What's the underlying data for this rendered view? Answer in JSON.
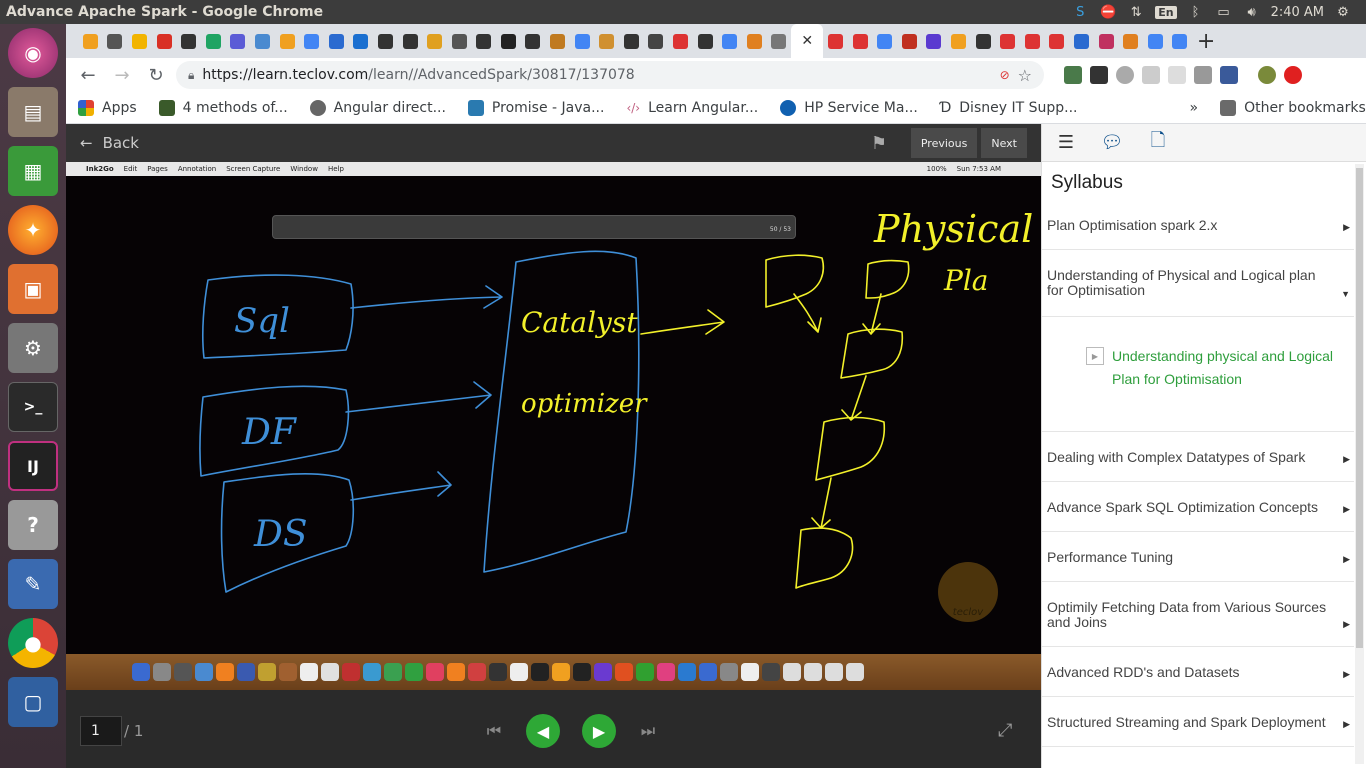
{
  "window_title": "Advance Apache Spark - Google Chrome",
  "panel": {
    "keyboard": "En",
    "time": "2:40 AM"
  },
  "browser": {
    "url_host": "https://learn.teclov.com",
    "url_path": "/learn//AdvancedSpark/30817/137078",
    "bookmarks": [
      "Apps",
      "4 methods of...",
      "Angular direct...",
      "Promise - Java...",
      "Learn Angular...",
      "HP Service Ma...",
      "Disney IT Supp...",
      "Other bookmarks"
    ],
    "bookmarks_overflow": "»"
  },
  "player": {
    "back_label": "Back",
    "previous_label": "Previous",
    "next_label": "Next",
    "page_current": "1",
    "page_total": "/ 1",
    "mac_menu": [
      "Ink2Go",
      "Edit",
      "Pages",
      "Annotation",
      "Screen Capture",
      "Window",
      "Help"
    ],
    "mac_status": "Sun 7:53 AM",
    "mac_battery": "100%",
    "toolbar_counter": "50 / 53",
    "watermark": "teclov",
    "drawing_texts": {
      "sql": "Sql",
      "df": "DF",
      "ds": "DS",
      "catalyst": "Catalyst",
      "optimizer": "optimizer",
      "physical": "Physical",
      "plan": "Pla"
    }
  },
  "sidebar": {
    "title": "Syllabus",
    "items": [
      {
        "label": "Plan Optimisation spark 2.x",
        "arrow": "▶"
      },
      {
        "label": "Understanding of Physical and Logical plan for Optimisation",
        "arrow": "▼"
      },
      {
        "label": "Dealing with Complex Datatypes of Spark",
        "arrow": "▶"
      },
      {
        "label": "Advance Spark SQL Optimization Concepts",
        "arrow": "▶"
      },
      {
        "label": "Performance Tuning",
        "arrow": "▶"
      },
      {
        "label": "Optimily Fetching Data from Various Sources and Joins",
        "arrow": "▶"
      },
      {
        "label": "Advanced RDD's and Datasets",
        "arrow": "▶"
      },
      {
        "label": "Structured Streaming and Spark Deployment",
        "arrow": "▶"
      }
    ],
    "sub_item": "Understanding physical and Logical Plan for Optimisation"
  },
  "colors": {
    "accent_green": "#2e9e3c",
    "chalk_blue": "#3f8fd8",
    "chalk_yellow": "#f2f02a"
  }
}
